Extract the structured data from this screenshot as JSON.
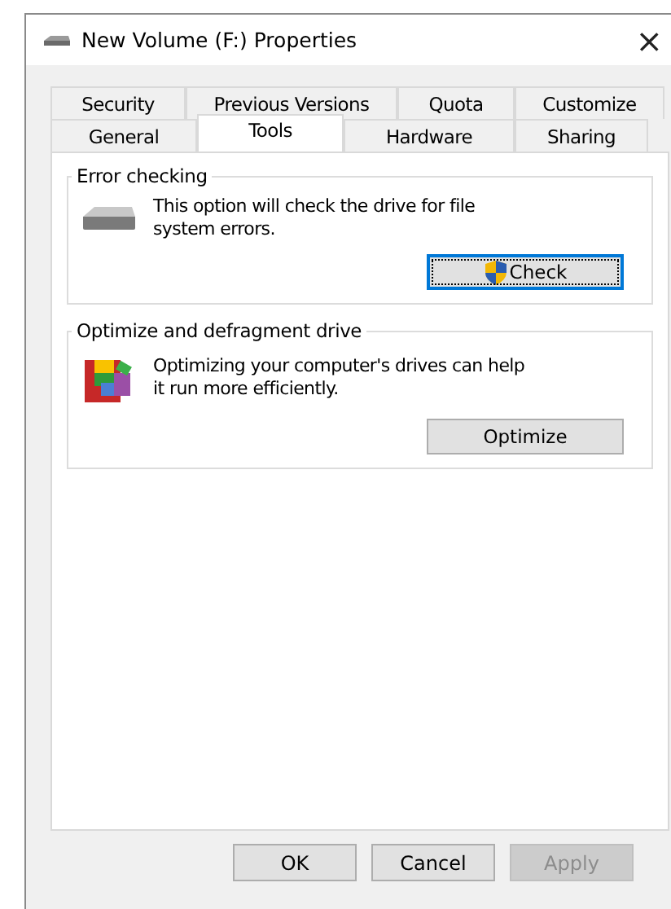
{
  "window": {
    "title": "New Volume (F:) Properties",
    "close": "×"
  },
  "tab_rows": [
    [
      {
        "label": "Security",
        "selected": false
      },
      {
        "label": "Previous Versions",
        "selected": false
      },
      {
        "label": "Quota",
        "selected": false
      },
      {
        "label": "Customize",
        "selected": false
      }
    ],
    [
      {
        "label": "General",
        "selected": false
      },
      {
        "label": "Tools",
        "selected": true
      },
      {
        "label": "Hardware",
        "selected": false
      },
      {
        "label": "Sharing",
        "selected": false
      }
    ]
  ],
  "groups": [
    {
      "kind": "drive",
      "title": "Error checking",
      "text": "This option will check the drive for file system errors.",
      "button": {
        "label": "Check",
        "shield": true,
        "focused": true
      }
    },
    {
      "kind": "defrag",
      "title": "Optimize and defragment drive",
      "text": "Optimizing your computer's drives can help it run more efficiently.",
      "button": {
        "label": "Optimize",
        "shield": false,
        "focused": false
      }
    }
  ],
  "buttons": [
    {
      "label": "OK",
      "disabled": false
    },
    {
      "label": "Cancel",
      "disabled": false
    },
    {
      "label": "Apply",
      "disabled": true
    }
  ]
}
